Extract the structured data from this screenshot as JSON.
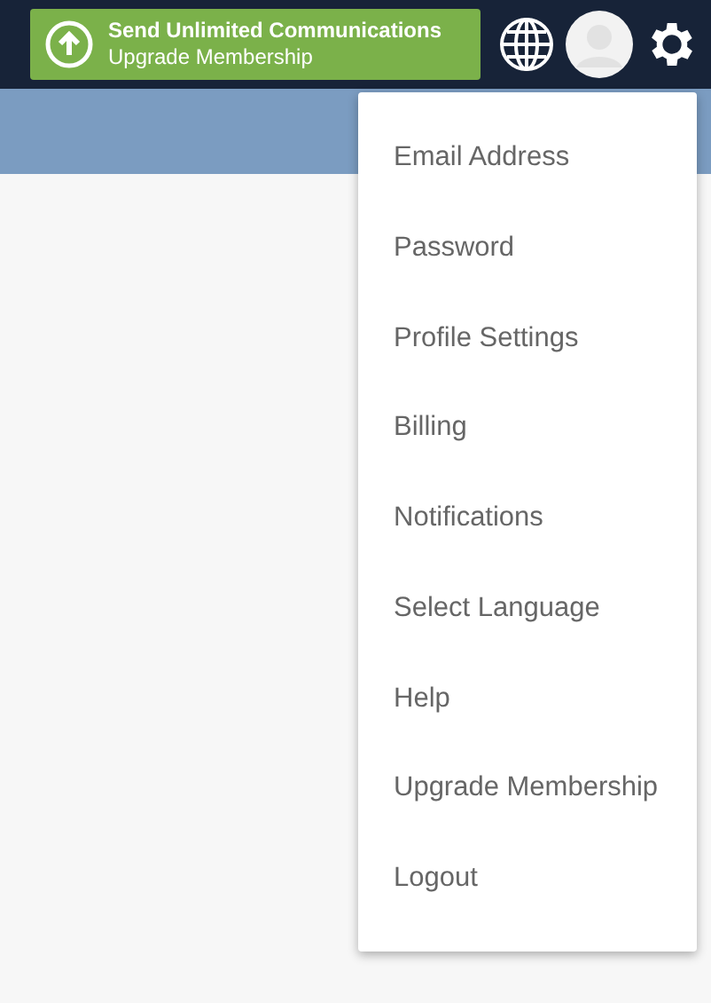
{
  "upgrade_banner": {
    "title": "Send Unlimited Communications",
    "subtitle": "Upgrade Membership"
  },
  "settings_menu": {
    "items": [
      {
        "label": "Email Address"
      },
      {
        "label": "Password"
      },
      {
        "label": "Profile Settings"
      },
      {
        "label": "Billing"
      },
      {
        "label": "Notifications"
      },
      {
        "label": "Select Language"
      },
      {
        "label": "Help"
      },
      {
        "label": "Upgrade Membership"
      },
      {
        "label": "Logout"
      }
    ]
  }
}
